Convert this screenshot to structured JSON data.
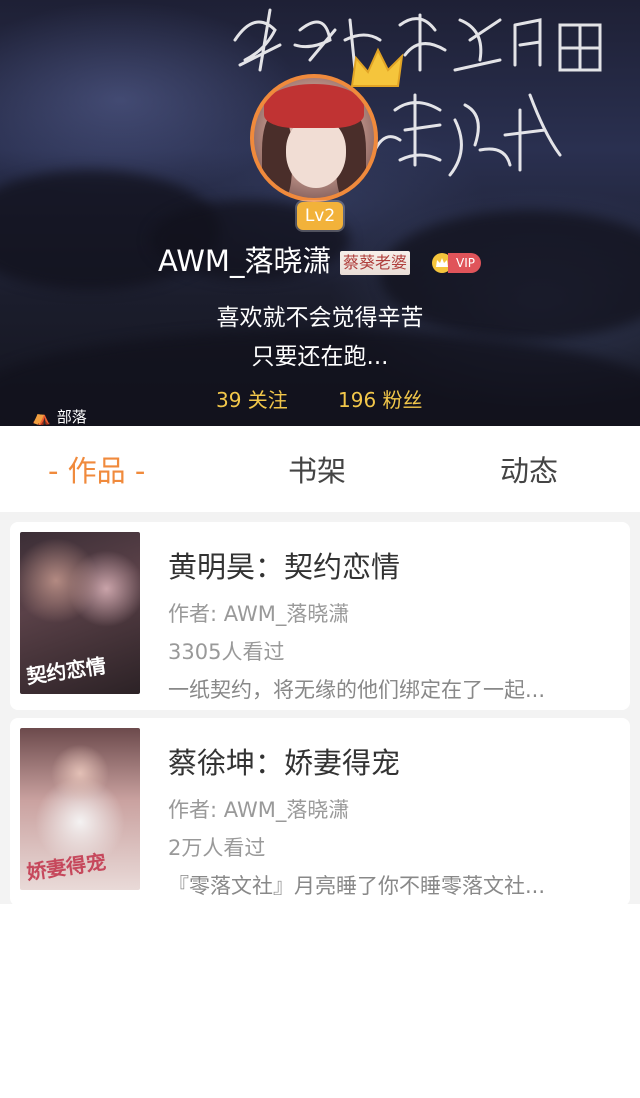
{
  "profile": {
    "banner_art_text": "Calligraphy artwork",
    "level": "Lv2",
    "username": "AWM_落晓潇",
    "title_tag": "蔡葵老婆",
    "vip_label": "VIP",
    "bio_line1": "喜欢就不会觉得辛苦",
    "bio_line2": "只要还在跑...",
    "following": "39 关注",
    "fans": "196 粉丝",
    "tribe": "部落"
  },
  "tabs": [
    {
      "label": "- 作品 -",
      "active": true
    },
    {
      "label": "书架",
      "active": false
    },
    {
      "label": "动态",
      "active": false
    }
  ],
  "books": [
    {
      "title": "黄明昊：契约恋情",
      "author": "作者: AWM_落晓潇",
      "views": "3305人看过",
      "description": "一纸契约，将无缘的他们绑定在了一起...",
      "cover_text": "契约恋情"
    },
    {
      "title": "蔡徐坤：娇妻得宠",
      "author": "作者: AWM_落晓潇",
      "views": "2万人看过",
      "description": "『零落文社』月亮睡了你不睡零落文社...",
      "cover_text": "娇妻得宠"
    }
  ],
  "colors": {
    "accent": "#f08a3c",
    "level_badge": "#f2b23a",
    "stats": "#f2c74a",
    "vip": "#e0545a"
  },
  "icons": {
    "crown": "crown-icon",
    "vip": "vip-crown-icon",
    "tribe": "tribe-icon"
  }
}
